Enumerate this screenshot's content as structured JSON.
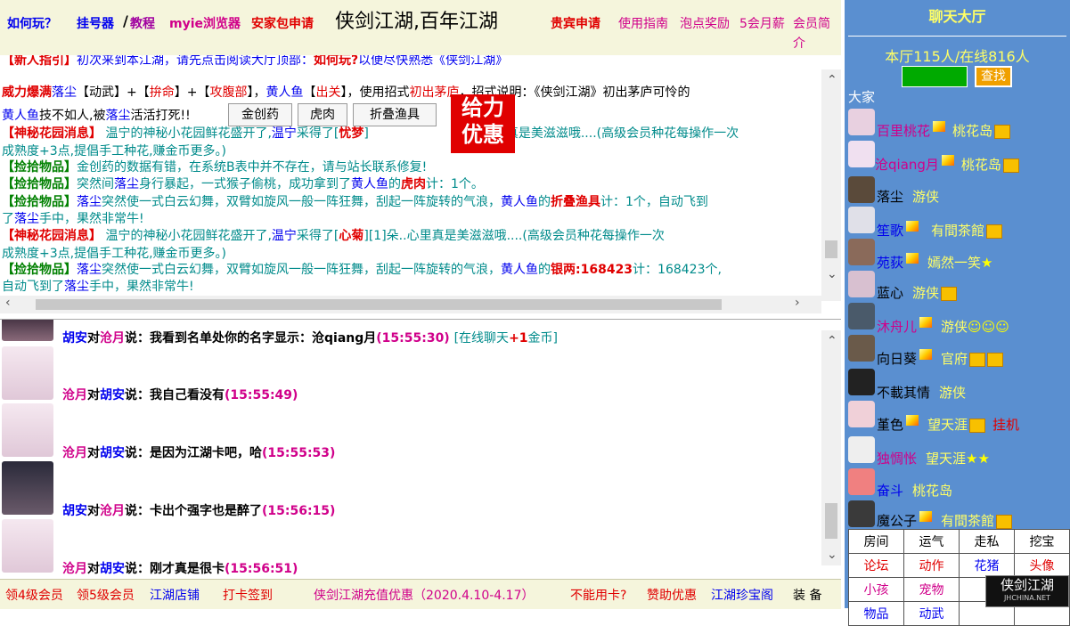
{
  "topbar": {
    "how_to_play": "如何玩？",
    "hanghaoqi": "挂号器",
    "slash": "/",
    "tutorial": "教程",
    "browser": "myie浏览器",
    "anjia": "安家包申请",
    "title": "侠剑江湖,百年江湖",
    "vip_apply": "贵宾申请",
    "guide": "使用指南",
    "bubble_reward": "泡点奖励",
    "salary": "5会月薪",
    "member_intro": "会员简介"
  },
  "sys_msgs": [
    {
      "p1": "【新人指引】",
      "p2": "初次来到本江湖，请先点击阅读大厅顶部：",
      "p3": "如何玩?",
      "p4": "以便尽快熟悉《侠剑江湖》"
    },
    {
      "p1": "威力爆满",
      "p2": "落尘",
      "p3": "【动武】+【",
      "p4": "拚命",
      "p5": "】+【",
      "p6": "攻腹部",
      "p7": "】，",
      "p8": "黄人鱼",
      "p9": "【",
      "p10": "出关",
      "p11": "】，使用招式",
      "p12": "初出茅庐",
      "p13": "，招式说明：《侠剑江湖》初出茅庐可怜的"
    },
    {
      "p1": "黄人鱼",
      "p2": "技不如人,被",
      "p3": "落尘",
      "p4": "活活打死!!"
    },
    {
      "p1": "【神秘花园消息】",
      "p2": " 温宁的神秘小花园鲜花盛开了,",
      "p3": "温宁",
      "p4": "采得了[",
      "p5": "忧梦",
      "p6": "]",
      "p7": "…心里真是美滋滋哦....(高级会员种花每操作一次"
    },
    {
      "p1": "成熟度+3点,提倡手工种花,赚金币更多。)"
    },
    {
      "p1": "【捡拾物品】",
      "p2": "金创药的数据有错，在系统B表中并不存在，请与站长联系修复!"
    },
    {
      "p1": "【捡拾物品】",
      "p2": "突然间",
      "p3": "落尘",
      "p4": "身行暴起，一式猴子偷桃，成功拿到了",
      "p5": "黄人鱼",
      "p6": "的",
      "p7": "虎肉",
      "p8": "计：1个。"
    },
    {
      "p1": "【捡拾物品】",
      "p2": "落尘",
      "p3": "突然使一式白云幻舞，双臂如旋风一般一阵狂舞，刮起一阵旋转的气浪，",
      "p4": "黄人鱼",
      "p5": "的",
      "p6": "折叠渔具",
      "p7": "计：1个，自动飞到"
    },
    {
      "p1": "了",
      "p2": "落尘",
      "p3": "手中，果然非常牛!"
    },
    {
      "p1": "【神秘花园消息】",
      "p2": " 温宁的神秘小花园鲜花盛开了,",
      "p3": "温宁",
      "p4": "采得了[",
      "p5": "心菊",
      "p6": "][1]朵..心里真是美滋滋哦....(高级会员种花每操作一次"
    },
    {
      "p1": "成熟度+3点,提倡手工种花,赚金币更多。)"
    },
    {
      "p1": "【捡拾物品】",
      "p2": "落尘",
      "p3": "突然使一式白云幻舞，双臂如旋风一般一阵狂舞，刮起一阵旋转的气浪，",
      "p4": "黄人鱼",
      "p5": "的",
      "p6": "银两:168423",
      "p7": "计：168423个,"
    },
    {
      "p1": "自动飞到了",
      "p2": "落尘",
      "p3": "手中，果然非常牛!"
    }
  ],
  "popup_buttons": [
    "金创药",
    "虎肉",
    "折叠渔具"
  ],
  "promo": {
    "line1": "给力",
    "line2": "优惠"
  },
  "chat": [
    {
      "from": "胡安",
      "dui": "对",
      "to": "沧月",
      "say": "说：我看到名单处你的名字显示：沧qiang月",
      "time": "(15:55:30)",
      "extra": "[在线聊天",
      "plus": "+1",
      "coin": "金币]"
    },
    {
      "from": "沧月",
      "dui": "对",
      "to": "胡安",
      "say": "说：我自己看没有",
      "time": "(15:55:49)"
    },
    {
      "from": "沧月",
      "dui": "对",
      "to": "胡安",
      "say": "说：是因为江湖卡吧，哈",
      "time": "(15:55:53)"
    },
    {
      "from": "胡安",
      "dui": "对",
      "to": "沧月",
      "say": "说：卡出个强字也是醉了",
      "time": "(15:56:15)"
    },
    {
      "from": "沧月",
      "dui": "对",
      "to": "胡安",
      "say": "说：刚才真是很卡",
      "time": "(15:56:51)"
    }
  ],
  "bottombar": [
    "领4级会员",
    "领5级会员",
    "江湖店铺",
    "打卡签到",
    "侠剑江湖充值优惠（2020.4.10-4.17）",
    "不能用卡?",
    "赞助优惠",
    "江湖珍宝阁",
    "装 备"
  ],
  "right": {
    "hall_title": "聊天大厅",
    "stats": "本厅115人/在线816人",
    "search_btn": "查找",
    "group": "大家",
    "users": [
      {
        "name": "百里桃花",
        "tag": "桃花岛",
        "color": "#d0008a"
      },
      {
        "name": "沧qiang月",
        "tag": "桃花岛",
        "color": "#d0008a"
      },
      {
        "name": "落尘",
        "tag": "游侠",
        "color": "#000000"
      },
      {
        "name": "笙歌",
        "tag": "有間茶館",
        "color": "#0000ee"
      },
      {
        "name": "苑荻",
        "tag": "嫣然一笑",
        "color": "#0000ee"
      },
      {
        "name": "蓝心",
        "tag": "游侠",
        "color": "#000000"
      },
      {
        "name": "沐舟儿",
        "tag": "游侠",
        "color": "#d0008a"
      },
      {
        "name": "向日葵",
        "tag": "官府",
        "color": "#000000"
      },
      {
        "name": "不載其情",
        "tag": "游侠",
        "color": "#000000"
      },
      {
        "name": "堇色",
        "tag": "望天涯",
        "color": "#000000",
        "extra": "挂机"
      },
      {
        "name": "独惆怅",
        "tag": "望天涯",
        "color": "#d0008a"
      },
      {
        "name": "奋斗",
        "tag": "桃花岛",
        "color": "#0000ee"
      },
      {
        "name": "魔公子",
        "tag": "有間茶館",
        "color": "#000000"
      }
    ],
    "grid": [
      [
        "房间",
        "运气",
        "走私",
        "挖宝"
      ],
      [
        "论坛",
        "动作",
        "花猪",
        "头像"
      ],
      [
        "小孩",
        "宠物",
        "",
        ""
      ],
      [
        "物品",
        "动武",
        "",
        ""
      ]
    ],
    "logo": "侠剑江湖",
    "logo_sub": "JHCHINA.NET"
  },
  "colors": {
    "topbar_bg": "#f5f5dc",
    "right_bg": "#5a8fd0",
    "accent_red": "#e00000",
    "accent_blue": "#0000ee",
    "magenta": "#d0008a"
  }
}
